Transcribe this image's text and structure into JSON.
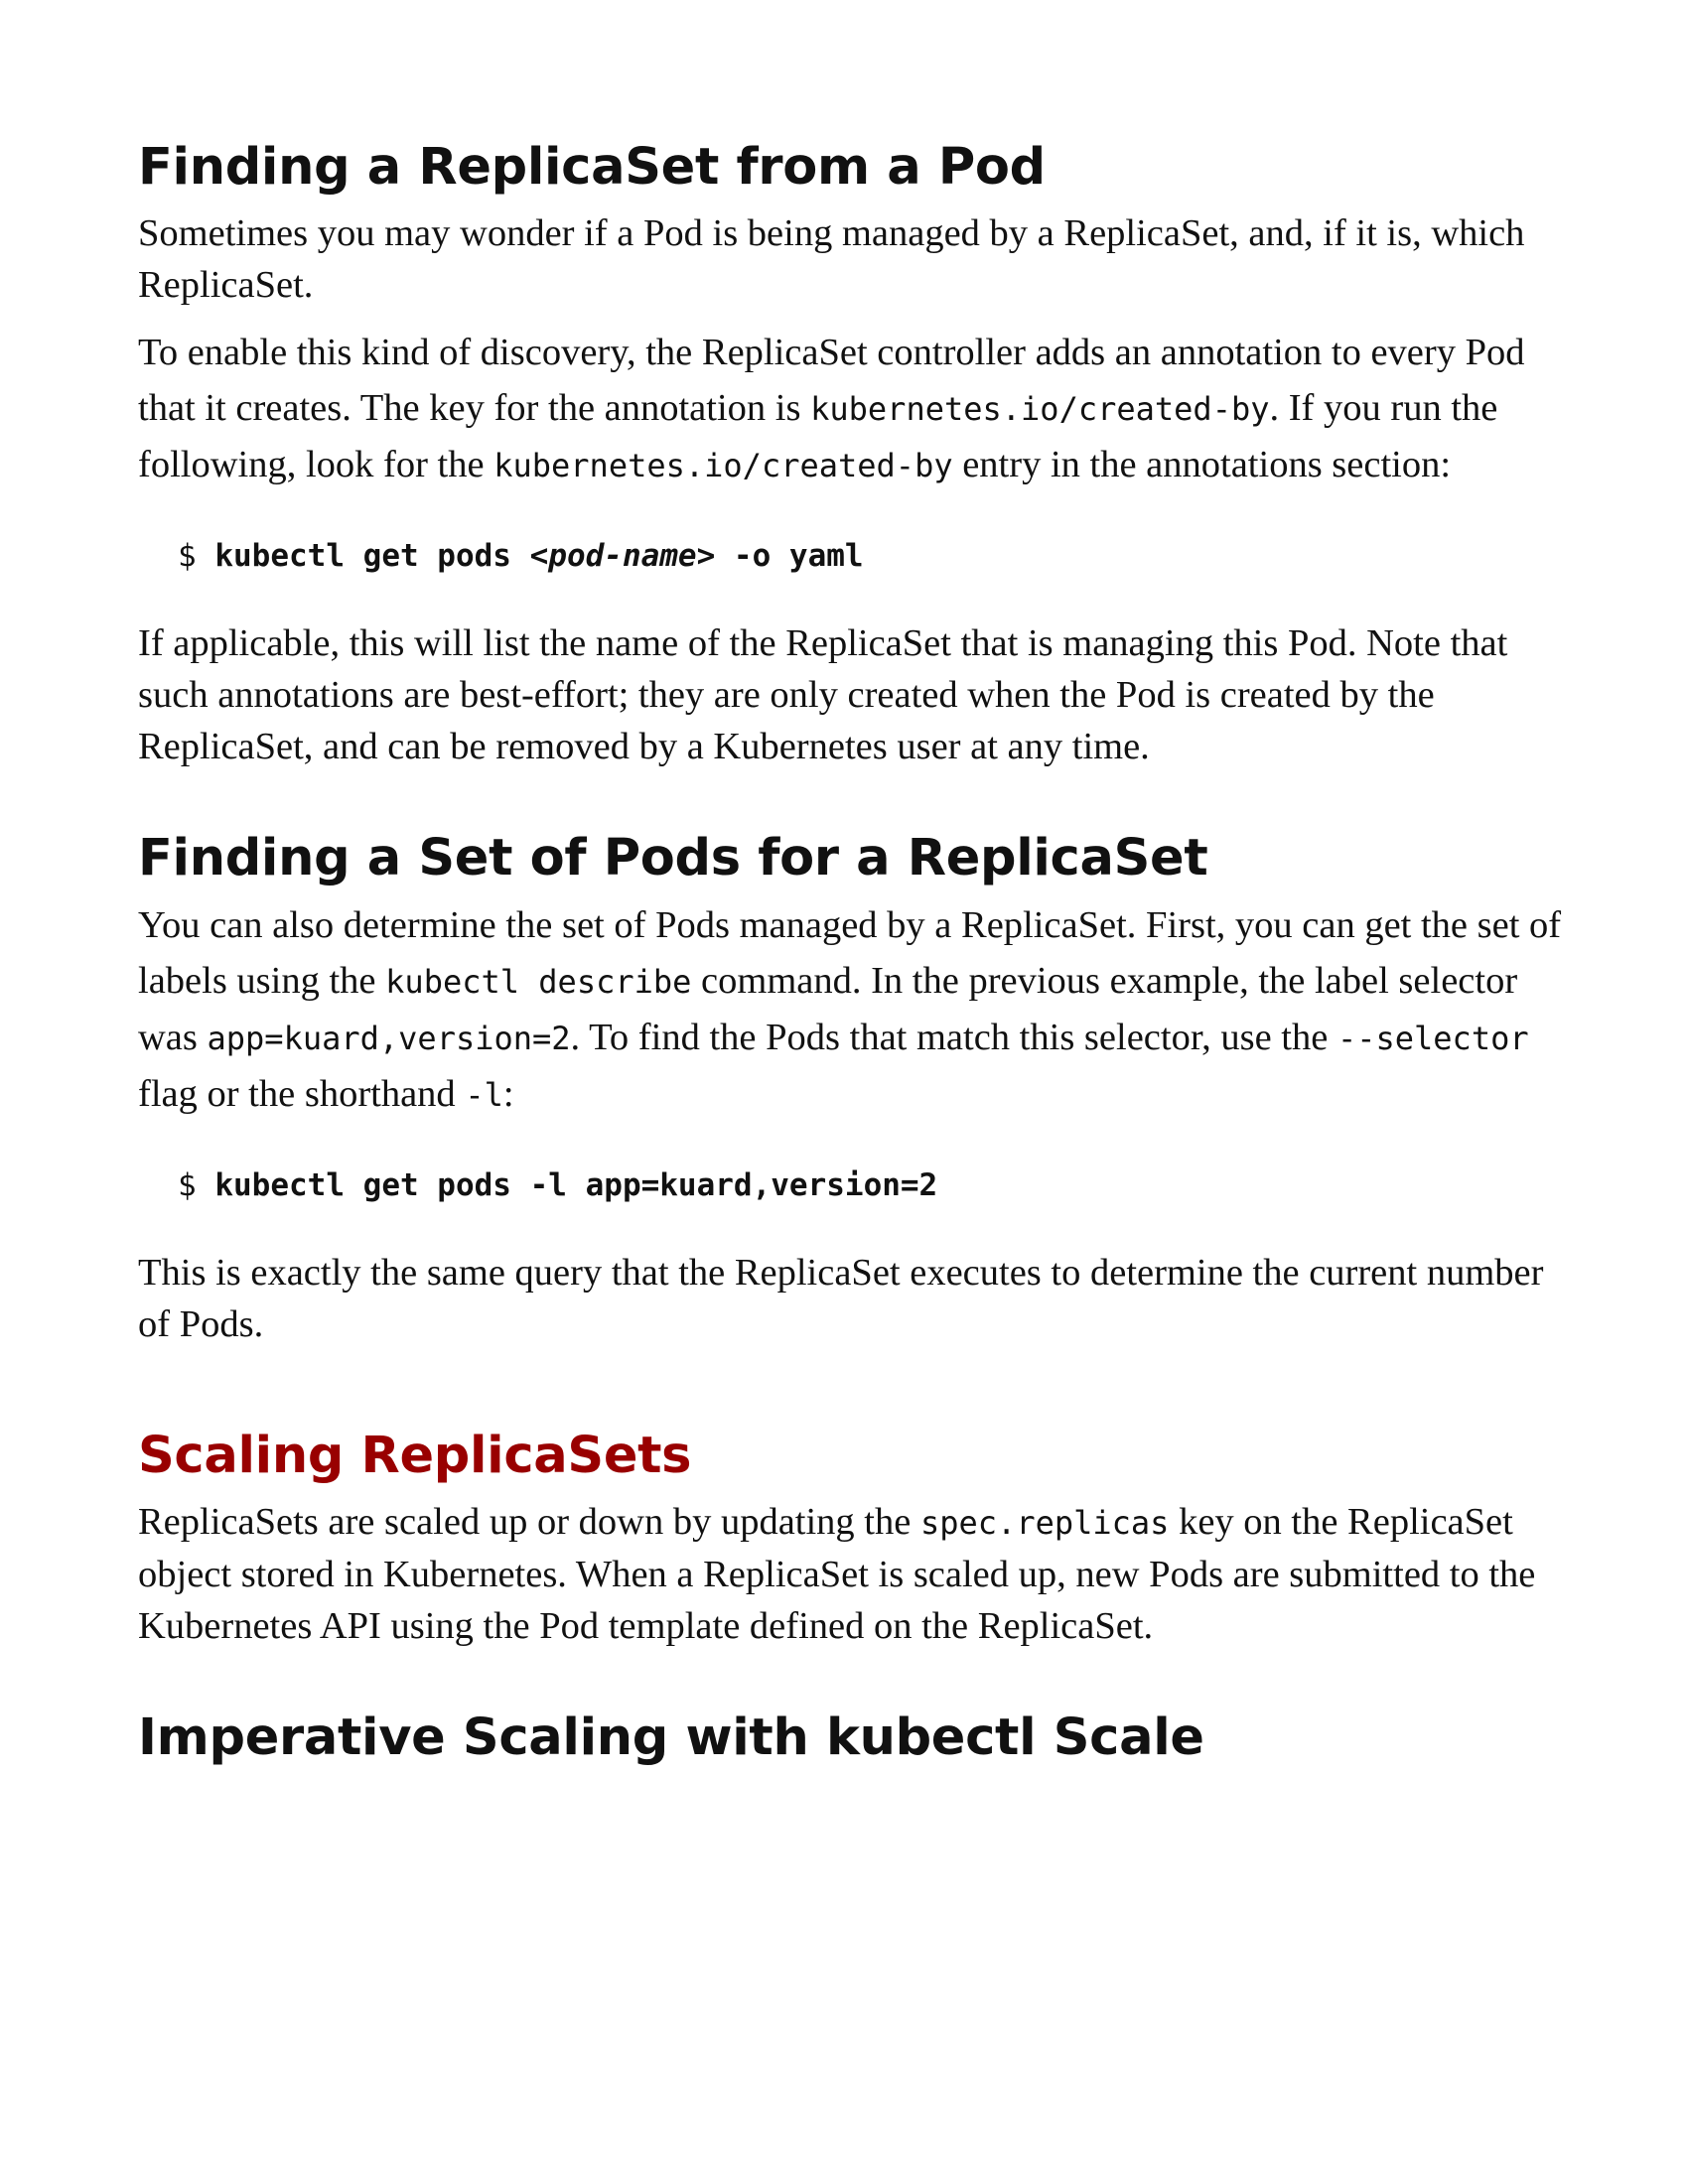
{
  "section1": {
    "heading": "Finding a ReplicaSet from a Pod",
    "p1": "Sometimes you may wonder if a Pod is being managed by a ReplicaSet, and, if it is, which ReplicaSet.",
    "p2_a": "To enable this kind of discovery, the ReplicaSet controller adds an annotation to every Pod that it creates. The key for the annotation is ",
    "p2_code1": "kubernetes.io/created-by",
    "p2_b": ". If you run the following, look for the ",
    "p2_code2": "kubernetes.io/created-by",
    "p2_c": " entry in the annotations section:",
    "cmd_prompt": "$",
    "cmd_a": "kubectl get pods ",
    "cmd_arg": "<pod-name>",
    "cmd_b": " -o yaml",
    "p3": "If applicable, this will list the name of the ReplicaSet that is managing this Pod. Note that such annotations are best-effort; they are only created when the Pod is created by the ReplicaSet, and can be removed by a Kubernetes user at any time."
  },
  "section2": {
    "heading": "Finding a Set of Pods for a ReplicaSet",
    "p1_a": "You can also determine the set of Pods managed by a ReplicaSet. First, you can get the set of labels using the ",
    "p1_code1": "kubectl describe",
    "p1_b": " command. In the previous example, the label selector was ",
    "p1_code2": "app=kuard,version=2",
    "p1_c": ". To find the Pods that match this selector, use the ",
    "p1_code3": "--selector",
    "p1_d": " flag or the shorthand ",
    "p1_code4": "-l",
    "p1_e": ":",
    "cmd_prompt": "$",
    "cmd": "kubectl get pods -l app=kuard,version=2",
    "p2": "This is exactly the same query that the ReplicaSet executes to determine the current number of Pods."
  },
  "section3": {
    "heading": "Scaling ReplicaSets",
    "p1_a": "ReplicaSets are scaled up or down by updating the ",
    "p1_code": "spec.replicas",
    "p1_b": " key on the ReplicaSet object stored in Kubernetes. When a ReplicaSet is scaled up, new Pods are submitted to the Kubernetes API using the Pod template defined on the ReplicaSet."
  },
  "section4": {
    "heading": "Imperative Scaling with kubectl Scale"
  },
  "colors": {
    "text": "#111111",
    "accent_heading": "#990000"
  }
}
